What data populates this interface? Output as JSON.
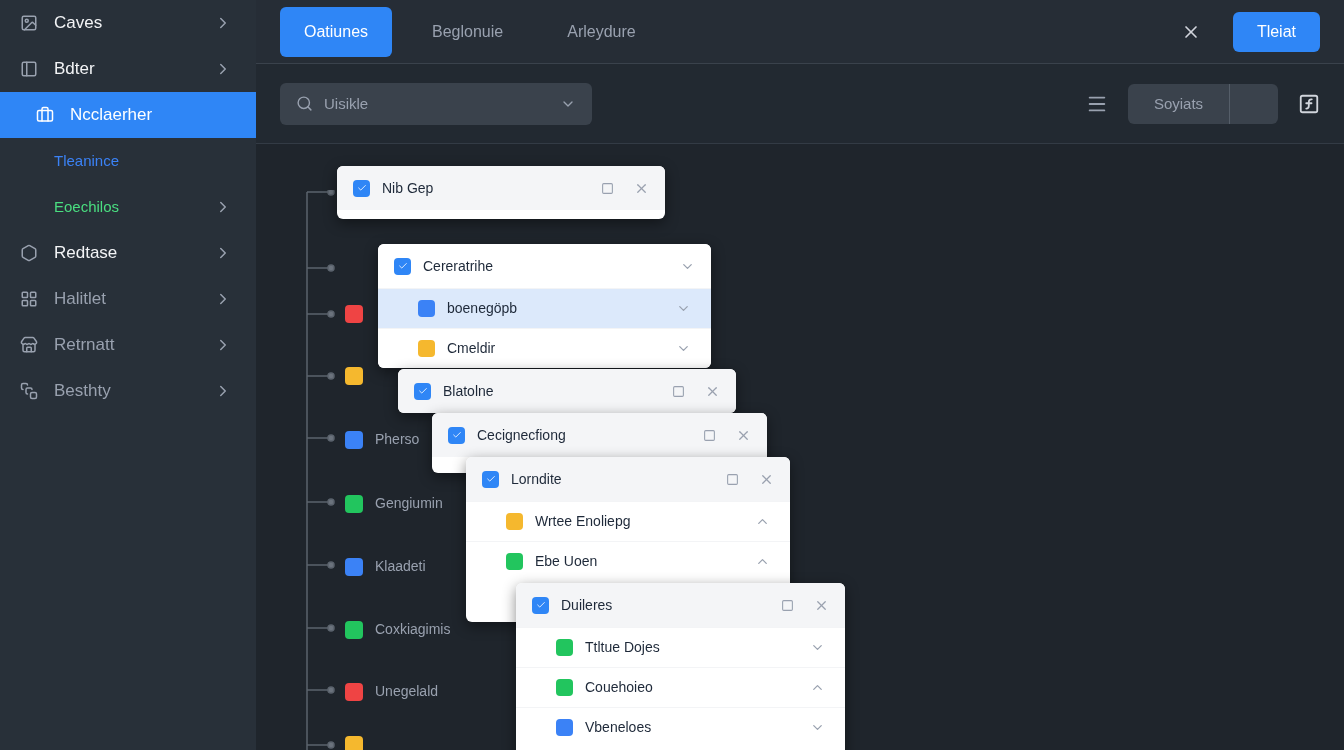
{
  "sidebar": {
    "items": [
      {
        "label": "Caves",
        "kind": "item",
        "selected": false,
        "chevron": true
      },
      {
        "label": "Bdter",
        "kind": "item",
        "selected": false,
        "chevron": true
      },
      {
        "label": "Ncclaerher",
        "kind": "item",
        "selected": true,
        "chevron": false
      },
      {
        "label": "Tleanince",
        "kind": "sub",
        "selected": false,
        "chevron": false,
        "color": "#3b82f6"
      },
      {
        "label": "Eoechilos",
        "kind": "sub",
        "selected": false,
        "chevron": true,
        "color": "#4ade80"
      },
      {
        "label": "Redtase",
        "kind": "item",
        "selected": false,
        "chevron": true
      },
      {
        "label": "Halitlet",
        "kind": "item",
        "selected": false,
        "chevron": true
      },
      {
        "label": "Retrnatt",
        "kind": "item",
        "selected": false,
        "chevron": true
      },
      {
        "label": "Besthty",
        "kind": "item",
        "selected": false,
        "chevron": true
      }
    ]
  },
  "tabs": [
    {
      "label": "Oatiunes",
      "selected": true
    },
    {
      "label": "Beglonuie",
      "selected": false
    },
    {
      "label": "Arleydure",
      "selected": false
    }
  ],
  "primary_button": "Tleiat",
  "toolbar": {
    "search": {
      "placeholder": "Uisikle"
    },
    "segment_button": "Soyiats"
  },
  "tree_nodes": [
    {
      "color": "#ef4444"
    },
    {
      "color": "#f5b82e"
    },
    {
      "color": "#3b82f6",
      "label": "Pherso"
    },
    {
      "color": "#22c55e",
      "label": "Gengiumin"
    },
    {
      "color": "#3b82f6",
      "label": "Klaadeti"
    },
    {
      "color": "#22c55e",
      "label": "Coxkiagimis"
    },
    {
      "color": "#ef4444",
      "label": "Unegelald"
    },
    {
      "color": "#f5b82e"
    }
  ],
  "cards": [
    {
      "title": "Nib Gep",
      "kind": "panel"
    },
    {
      "title": "Cereratrihe",
      "kind": "group",
      "rows": [
        {
          "label": "boenegöpb",
          "color": "#3b82f6",
          "selected": true,
          "expanded": false
        },
        {
          "label": "Cmeldir",
          "color": "#f5b82e",
          "selected": false,
          "expanded": false
        }
      ]
    },
    {
      "title": "Blatolne",
      "kind": "panel"
    },
    {
      "title": "Cecignecfiong",
      "kind": "panel"
    },
    {
      "title": "Lorndite",
      "kind": "panel",
      "rows": [
        {
          "label": "Wrtee Enoliepg",
          "color": "#f5b82e",
          "selected": false,
          "expanded": true
        },
        {
          "label": "Ebe Uoen",
          "color": "#22c55e",
          "selected": false,
          "expanded": true
        }
      ]
    },
    {
      "title": "Duileres",
      "kind": "panel",
      "rows": [
        {
          "label": "Ttltue Dojes",
          "color": "#22c55e",
          "selected": false,
          "expanded": false
        },
        {
          "label": "Couehoieo",
          "color": "#22c55e",
          "selected": false,
          "expanded": true
        },
        {
          "label": "Vbeneloes",
          "color": "#3b82f6",
          "selected": false,
          "expanded": false
        }
      ]
    }
  ]
}
